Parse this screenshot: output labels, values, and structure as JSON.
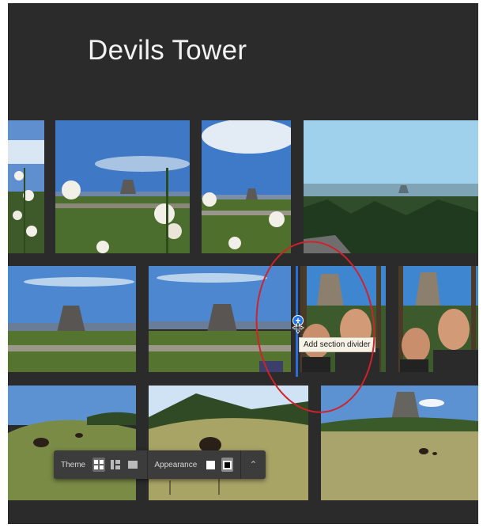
{
  "page": {
    "title": "Devils Tower"
  },
  "photos": [
    {
      "subject": "hollyhock flowers"
    },
    {
      "subject": "Devils Tower with hollyhocks"
    },
    {
      "subject": "hollyhocks and Devils Tower"
    },
    {
      "subject": "Devils Tower distant view over pine forest"
    },
    {
      "subject": "Devils Tower across prairie"
    },
    {
      "subject": "Devils Tower across prairie"
    },
    {
      "subject": "selfie with Devils Tower"
    },
    {
      "subject": "selfie with Devils Tower"
    },
    {
      "subject": "bison on grassy hills"
    },
    {
      "subject": "bison on meadow"
    },
    {
      "subject": "Devils Tower over meadow"
    }
  ],
  "divider": {
    "plus_glyph": "+",
    "tooltip": "Add section divider"
  },
  "toolbar": {
    "theme_label": "Theme",
    "appearance_label": "Appearance",
    "icons": [
      "grid-layout-icon",
      "columns-layout-icon",
      "single-layout-icon",
      "white-swatch",
      "black-swatch",
      "chevron-up-icon"
    ],
    "chevron_glyph": "⌃"
  },
  "colors": {
    "canvas": "#2b2b2b",
    "accent": "#1f74e8",
    "annotation": "#d0222a"
  }
}
